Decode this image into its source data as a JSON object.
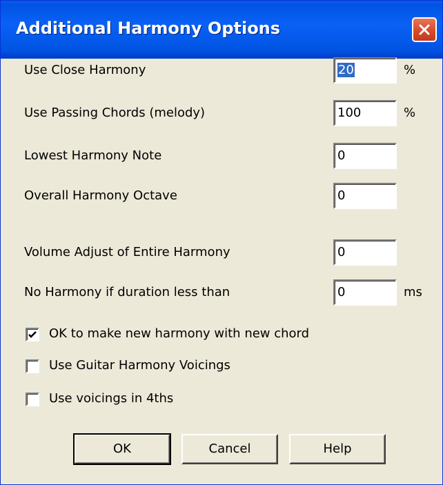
{
  "window": {
    "title": "Additional Harmony Options"
  },
  "fields": [
    {
      "label": "Use Close Harmony",
      "value": "20",
      "unit": "%"
    },
    {
      "label": "Use Passing Chords (melody)",
      "value": "100",
      "unit": "%"
    },
    {
      "label": "Lowest Harmony Note",
      "value": "0",
      "unit": ""
    },
    {
      "label": "Overall Harmony Octave",
      "value": "0",
      "unit": ""
    },
    {
      "label": "Volume Adjust of Entire Harmony",
      "value": "0",
      "unit": ""
    },
    {
      "label": "No Harmony if duration less than",
      "value": "0",
      "unit": "ms"
    }
  ],
  "checkboxes": [
    {
      "label": "OK to make new harmony with new chord",
      "checked": true
    },
    {
      "label": "Use Guitar Harmony Voicings",
      "checked": false
    },
    {
      "label": "Use voicings in 4ths",
      "checked": false
    }
  ],
  "buttons": {
    "ok": "OK",
    "cancel": "Cancel",
    "help": "Help"
  },
  "icons": {
    "close": "close-icon",
    "check": "checkmark-icon"
  },
  "colors": {
    "titlebar": "#0054e3",
    "close": "#d84a2c",
    "selection": "#316ac5",
    "face": "#ece9d8"
  }
}
